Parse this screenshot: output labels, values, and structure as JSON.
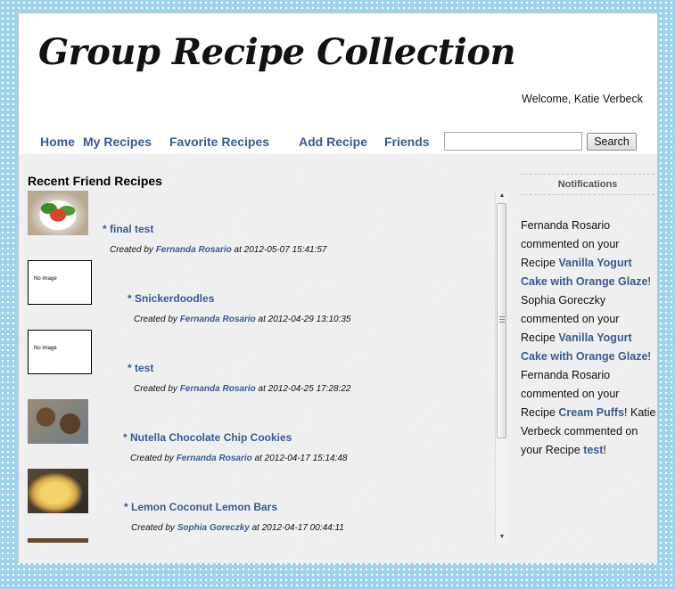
{
  "header": {
    "site_title": "Group Recipe Collection",
    "welcome": "Welcome, Katie Verbeck"
  },
  "nav": {
    "home": "Home",
    "my_recipes": "My Recipes",
    "favorite_recipes": "Favorite Recipes",
    "add_recipe": "Add Recipe",
    "friends": "Friends",
    "search_value": "",
    "search_button": "Search"
  },
  "recent": {
    "heading": "Recent Friend Recipes",
    "created_by_label": "Created by",
    "at_label": "at",
    "no_image_text": "No image",
    "items": [
      {
        "title": "* final test",
        "author": "Fernanda Rosario",
        "datetime": "2012-05-07 15:41:57",
        "image": "salad"
      },
      {
        "title": "* Snickerdoodles",
        "author": "Fernanda Rosario",
        "datetime": "2012-04-29 13:10:35",
        "image": "none"
      },
      {
        "title": "* test",
        "author": "Fernanda Rosario",
        "datetime": "2012-04-25 17:28:22",
        "image": "none"
      },
      {
        "title": "* Nutella Chocolate Chip Cookies",
        "author": "Fernanda Rosario",
        "datetime": "2012-04-17 15:14:48",
        "image": "cookies"
      },
      {
        "title": "* Lemon Coconut Lemon Bars",
        "author": "Sophia Goreczky",
        "datetime": "2012-04-17 00:44:11",
        "image": "bars"
      }
    ]
  },
  "notifications": {
    "heading": "Notifications",
    "items": [
      {
        "text": "Fernanda Rosario commented on your Recipe",
        "link": "Vanilla Yogurt Cake with Orange Glaze"
      },
      {
        "text": "Sophia Goreczky commented on your Recipe",
        "link": "Vanilla Yogurt Cake with Orange Glaze"
      },
      {
        "text": "Fernanda Rosario commented on your Recipe",
        "link": "Cream Puffs"
      },
      {
        "text": "Katie Verbeck commented on your Recipe",
        "link": "test"
      }
    ]
  },
  "colors": {
    "link": "#3a5a93",
    "page_background": "#9fd3ec",
    "content_background": "#efefef"
  }
}
